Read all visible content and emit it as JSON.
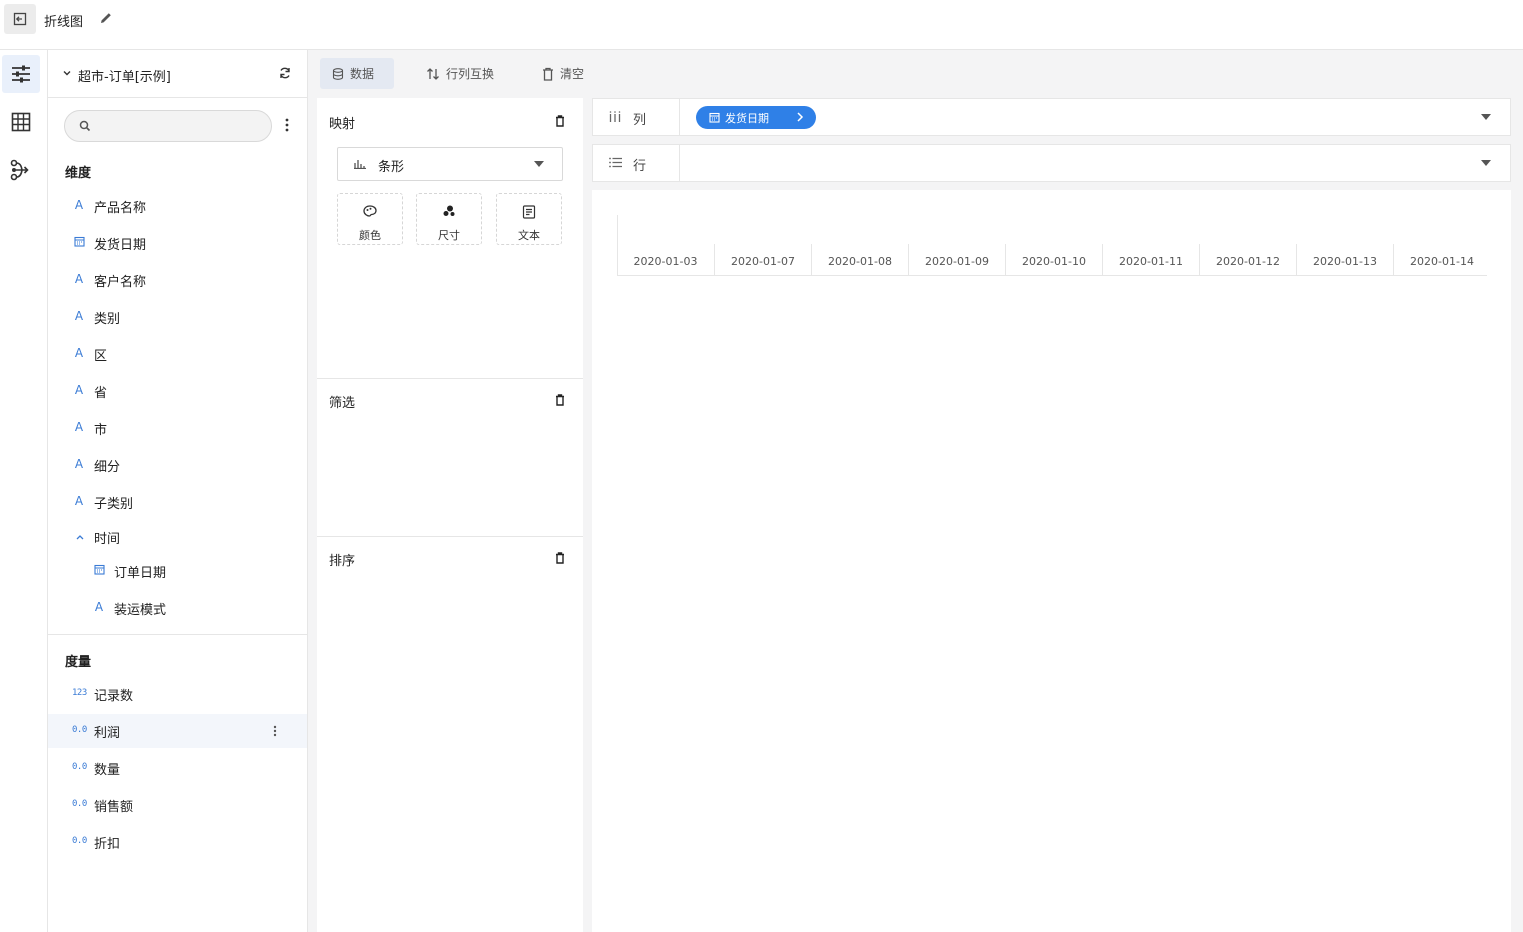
{
  "header": {
    "title": "折线图"
  },
  "rail": {
    "items": [
      "settings-sliders-icon",
      "table-grid-icon",
      "flow-icon"
    ]
  },
  "datasource": {
    "name": "超市-订单[示例]"
  },
  "search": {
    "placeholder": "",
    "value": ""
  },
  "dimensions": {
    "title": "维度",
    "items": [
      {
        "type": "A",
        "label": "产品名称"
      },
      {
        "type": "date",
        "label": "发货日期"
      },
      {
        "type": "A",
        "label": "客户名称"
      },
      {
        "type": "A",
        "label": "类别"
      },
      {
        "type": "A",
        "label": "区"
      },
      {
        "type": "A",
        "label": "省"
      },
      {
        "type": "A",
        "label": "市"
      },
      {
        "type": "A",
        "label": "细分"
      },
      {
        "type": "A",
        "label": "子类别"
      }
    ],
    "group": {
      "label": "时间",
      "items": [
        {
          "type": "date",
          "label": "订单日期"
        },
        {
          "type": "A",
          "label": "装运模式"
        }
      ]
    }
  },
  "measures": {
    "title": "度量",
    "items": [
      {
        "type": "123",
        "label": "记录数"
      },
      {
        "type": "0.0",
        "label": "利润"
      },
      {
        "type": "0.0",
        "label": "数量"
      },
      {
        "type": "0.0",
        "label": "销售额"
      },
      {
        "type": "0.0",
        "label": "折扣"
      }
    ]
  },
  "toolbar": {
    "data_label": "数据",
    "swap_label": "行列互换",
    "clear_label": "清空"
  },
  "config": {
    "mapping_title": "映射",
    "chart_type": "条形",
    "encodings": [
      "颜色",
      "尺寸",
      "文本"
    ],
    "filter_title": "筛选",
    "sort_title": "排序"
  },
  "shelves": {
    "columns_label": "列",
    "rows_label": "行",
    "column_pill": "发货日期"
  },
  "axis": {
    "ticks": [
      "2020-01-03",
      "2020-01-07",
      "2020-01-08",
      "2020-01-09",
      "2020-01-10",
      "2020-01-11",
      "2020-01-12",
      "2020-01-13",
      "2020-01-14"
    ]
  },
  "colors": {
    "accent": "#2f80e7",
    "type_icon": "#3a7bd5"
  }
}
